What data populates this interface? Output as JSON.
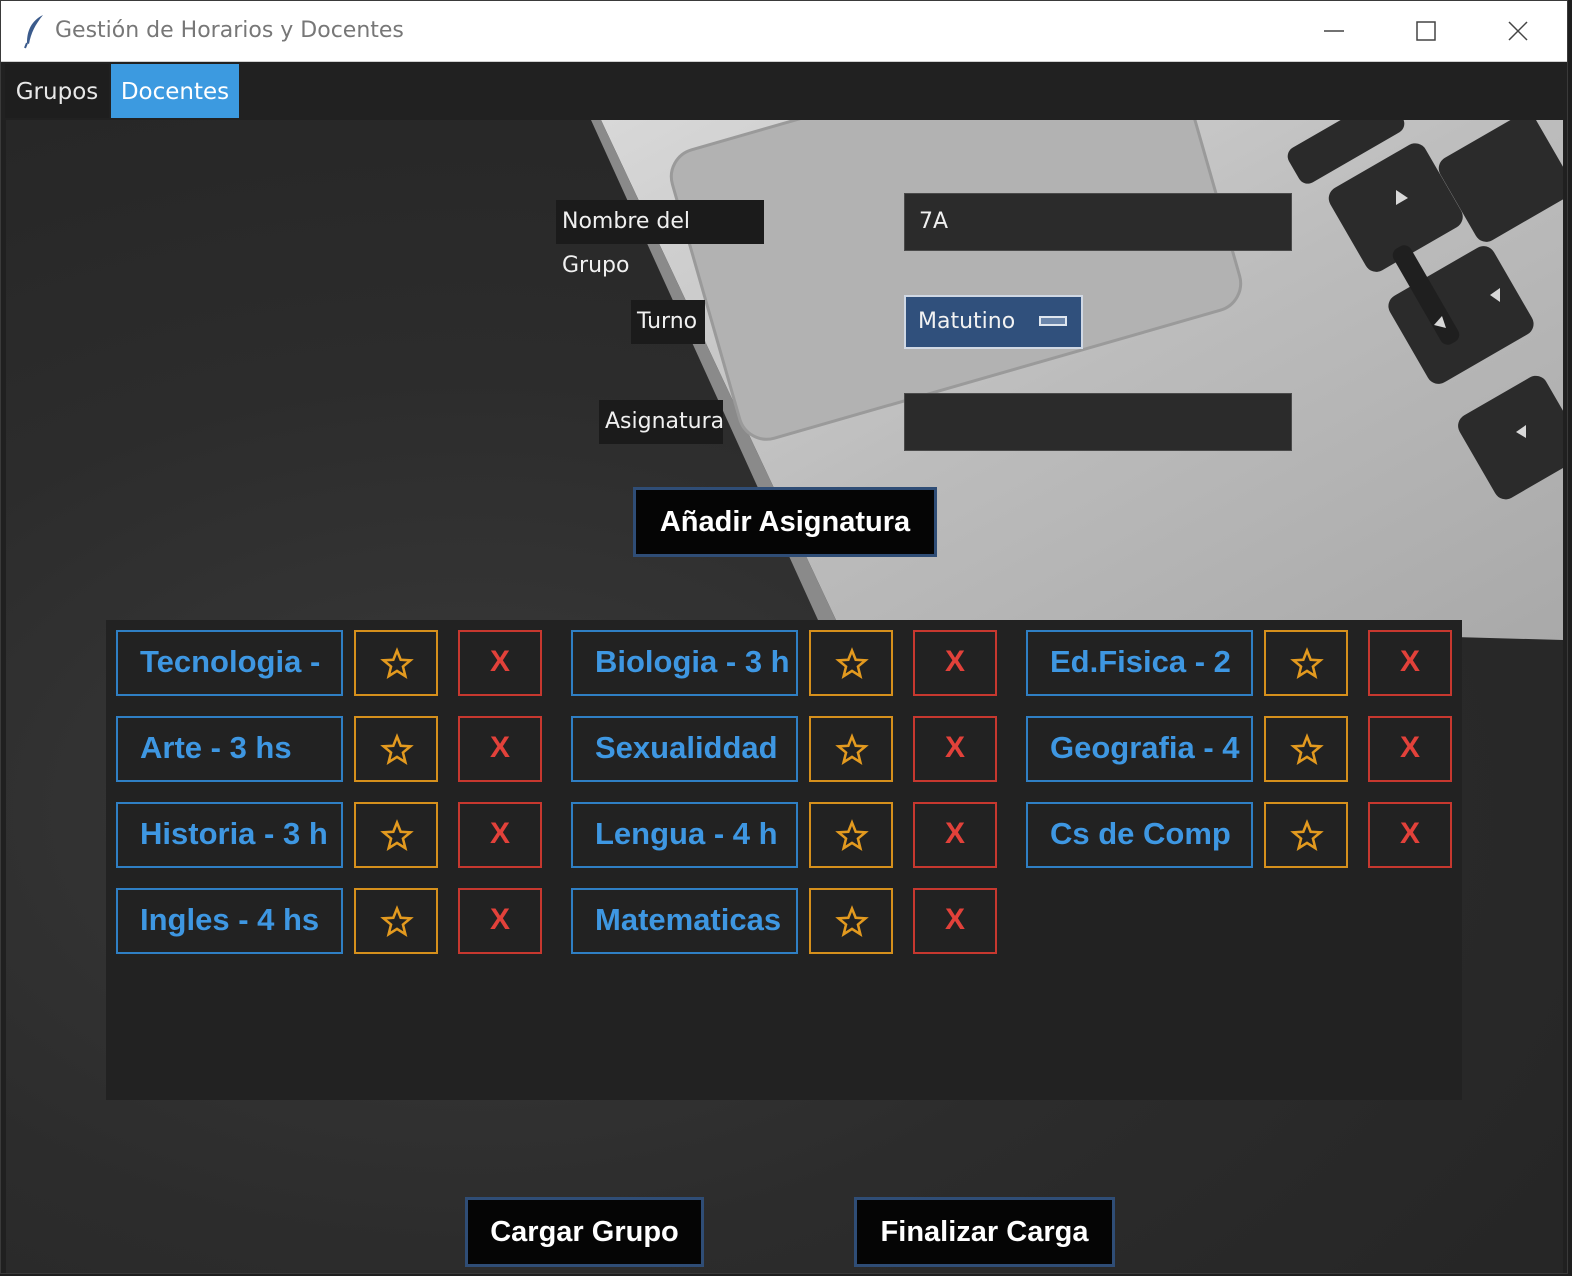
{
  "window": {
    "title": "Gestión de Horarios y Docentes"
  },
  "tabs": [
    {
      "label": "Grupos",
      "active": false
    },
    {
      "label": "Docentes",
      "active": true
    }
  ],
  "form": {
    "nombre_label": "Nombre del Grupo",
    "nombre_value": "7A",
    "turno_label": "Turno",
    "turno_value": "Matutino",
    "asignatura_label": "Asignatura",
    "asignatura_value": "",
    "add_button": "Añadir Asignatura"
  },
  "subjects": [
    {
      "label": "Tecnologia -"
    },
    {
      "label": "Biologia - 3 h"
    },
    {
      "label": "Ed.Fisica - 2"
    },
    {
      "label": "Arte - 3 hs"
    },
    {
      "label": "Sexualiddad"
    },
    {
      "label": "Geografia - 4"
    },
    {
      "label": "Historia - 3 h"
    },
    {
      "label": "Lengua - 4 h"
    },
    {
      "label": "Cs de Comp"
    },
    {
      "label": "Ingles - 4 hs"
    },
    {
      "label": "Matematicas"
    }
  ],
  "subject_actions": {
    "favorite_icon": "star-icon",
    "delete_label": "X"
  },
  "footer": {
    "load_button": "Cargar Grupo",
    "finish_button": "Finalizar Carga"
  },
  "colors": {
    "accent_tab": "#3c9ae0",
    "subject_blue": "#3e97e2",
    "star_orange": "#d6901c",
    "delete_red": "#e2413a"
  }
}
